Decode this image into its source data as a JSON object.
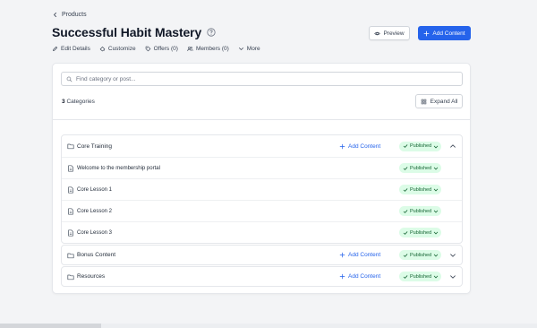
{
  "breadcrumb": {
    "label": "Products"
  },
  "page": {
    "title": "Successful Habit Mastery"
  },
  "header": {
    "preview_label": "Preview",
    "add_content_label": "Add Content"
  },
  "subnav": {
    "items": [
      {
        "label": "Edit Details",
        "icon": "pencil-icon"
      },
      {
        "label": "Customize",
        "icon": "paint-icon"
      },
      {
        "label": "Offers (0)",
        "icon": "tag-icon"
      },
      {
        "label": "Members (0)",
        "icon": "users-icon"
      },
      {
        "label": "More",
        "icon": "chevron-down-icon"
      }
    ]
  },
  "search": {
    "placeholder": "Find category or post...",
    "value": ""
  },
  "categories_summary": {
    "count": "3",
    "label": "Categories"
  },
  "expand_all_label": "Expand All",
  "categories": [
    {
      "title": "Core Training",
      "add_label": "Add Content",
      "status": "Published",
      "expanded": true,
      "posts": [
        {
          "title": "Welcome to the membership portal",
          "status": "Published"
        },
        {
          "title": "Core Lesson 1",
          "status": "Published"
        },
        {
          "title": "Core Lesson 2",
          "status": "Published"
        },
        {
          "title": "Core Lesson 3",
          "status": "Published"
        }
      ]
    },
    {
      "title": "Bonus Content",
      "add_label": "Add Content",
      "status": "Published",
      "expanded": false
    },
    {
      "title": "Resources",
      "add_label": "Add Content",
      "status": "Published",
      "expanded": false
    }
  ],
  "colors": {
    "accent": "#2563eb",
    "badge_bg": "#dcfce7",
    "badge_text": "#166534",
    "background": "#f3f4f6"
  }
}
